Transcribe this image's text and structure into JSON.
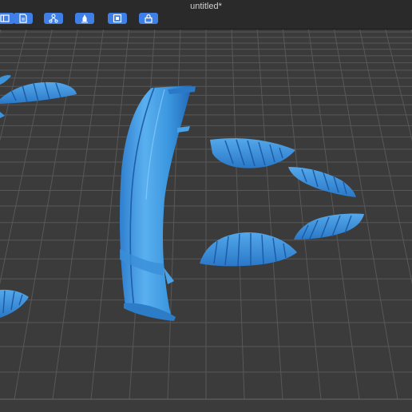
{
  "window": {
    "title": "untitled*"
  },
  "toolbar": [
    {
      "name": "panel-toggle-button",
      "icon": "sidebar-panel-icon"
    },
    {
      "name": "open-file-button",
      "icon": "file-icon"
    },
    {
      "name": "network-button",
      "icon": "network-icon"
    },
    {
      "name": "support-button",
      "icon": "support-icon"
    },
    {
      "name": "frame-view-button",
      "icon": "frame-icon"
    },
    {
      "name": "lock-button",
      "icon": "lock-icon"
    }
  ],
  "colors": {
    "accent": "#3e80e8",
    "model": "#3f97e0",
    "background": "#3a3a3a",
    "grid": "#555555"
  }
}
